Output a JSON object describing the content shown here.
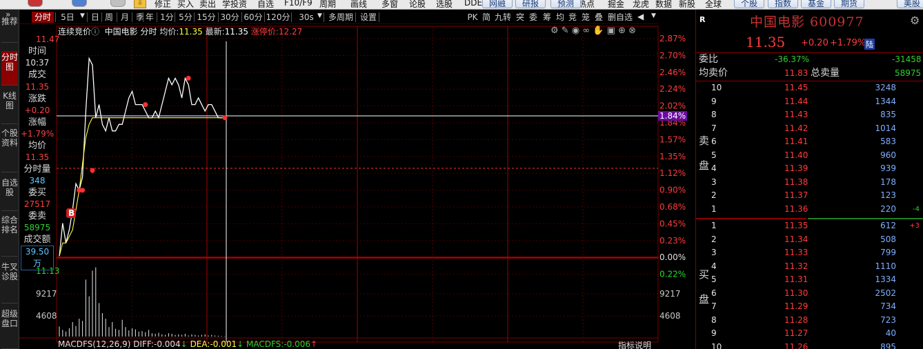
{
  "toolbar": {
    "items": [
      "修正",
      "买入",
      "卖出",
      "学投资",
      "自选",
      "F10/F9",
      "周期",
      "画线",
      "多窗",
      "论股",
      "选股",
      "DDE",
      "热点",
      "掘金",
      "龙虎",
      "数据",
      "新股",
      "全球"
    ],
    "buttons": [
      "网融",
      "研报",
      "预测",
      "个股",
      "指数",
      "基金",
      "期货",
      "美股"
    ]
  },
  "leftnav": [
    "推荐",
    "分时图",
    "K线图",
    "个股资料",
    "自选股",
    "综合排名",
    "牛叉诊股",
    "超级盘口"
  ],
  "periodbar": {
    "items": [
      "分时",
      "5日",
      "日",
      "周",
      "月",
      "季",
      "年",
      "1分",
      "5分",
      "15分",
      "30分",
      "60分",
      "120分",
      "30s",
      "多周期",
      "设置"
    ],
    "right": [
      "PK",
      "简",
      "九转",
      "突",
      "委",
      "筹",
      "均",
      "竞",
      "笼",
      "叠",
      "删自选"
    ]
  },
  "chart_title": {
    "mode": "连续竞价",
    "name": "中国电影",
    "view": "分时",
    "avg_label": "均价:",
    "avg_value": "11.35",
    "last_label": "最新:",
    "last_value": "11.35",
    "limit_label": "涨停价:",
    "limit_value": "12.27"
  },
  "info": {
    "time_label": "时间",
    "time": "10:37",
    "deal_label": "成交",
    "deal": "11.35",
    "change_label": "涨跌",
    "change": "+0.20",
    "pct_label": "涨幅",
    "pct": "+1.79%",
    "avg_label": "均价",
    "avg": "11.35",
    "vol_label": "分时量",
    "vol": "348",
    "bid_label": "委买",
    "bid": "27517",
    "ask_label": "委卖",
    "ask": "58975",
    "amt_label": "成交额",
    "amt": "39.50万"
  },
  "chart_data": {
    "type": "line",
    "y_left_top": "11.47",
    "y_left_bottom": "11.13",
    "pct_ticks": [
      "2.87%",
      "2.70%",
      "2.46%",
      "2.24%",
      "2.02%",
      "1.84%",
      "1.57%",
      "1.35%",
      "1.12%",
      "0.90%",
      "0.68%",
      "0.45%",
      "0.23%",
      "0.00%",
      "0.22%"
    ],
    "current_pct": "1.84%",
    "vol_ticks": [
      "9217",
      "4608"
    ],
    "buy_marker": "B",
    "price_series": [
      11.14,
      11.19,
      11.16,
      11.18,
      11.21,
      11.25,
      11.24,
      11.26,
      11.36,
      11.44,
      11.43,
      11.35,
      11.37,
      11.34,
      11.33,
      11.35,
      11.33,
      11.33,
      11.34,
      11.34,
      11.36,
      11.38,
      11.39,
      11.37,
      11.37,
      11.37,
      11.36,
      11.35,
      11.35,
      11.36,
      11.35,
      11.37,
      11.39,
      11.41,
      11.4,
      11.41,
      11.4,
      11.38,
      11.41,
      11.4,
      11.37,
      11.37,
      11.38,
      11.37,
      11.36,
      11.37,
      11.37,
      11.36,
      11.35,
      11.35,
      11.35
    ],
    "avg_series": [
      11.14,
      11.16,
      11.16,
      11.17,
      11.18,
      11.21,
      11.24,
      11.28,
      11.32,
      11.34,
      11.35,
      11.35,
      11.35,
      11.35,
      11.35,
      11.35,
      11.35,
      11.35,
      11.35,
      11.35,
      11.35,
      11.35,
      11.35,
      11.35,
      11.35,
      11.35,
      11.35,
      11.35,
      11.35,
      11.35,
      11.35,
      11.35,
      11.35,
      11.35,
      11.35,
      11.35,
      11.35,
      11.35,
      11.35,
      11.35,
      11.35,
      11.35,
      11.35,
      11.35,
      11.35,
      11.35,
      11.35,
      11.35,
      11.35,
      11.35,
      11.35
    ],
    "volume_series": [
      1800,
      1200,
      900,
      1500,
      2600,
      1900,
      3200,
      2800,
      10200,
      7200,
      11800,
      12400,
      6000,
      4200,
      3200,
      1700,
      2600,
      1400,
      1200,
      3000,
      1700,
      1100,
      1500,
      1300,
      900,
      1000,
      800,
      1200,
      600,
      500,
      700,
      400,
      300,
      600,
      500,
      300,
      400,
      300,
      500,
      200,
      400,
      300,
      200,
      300,
      400,
      200,
      300,
      200,
      150,
      100,
      80
    ],
    "prev_close": 11.15
  },
  "macd": {
    "label": "MACDFS(12,26,9)",
    "diff_label": "DIFF:",
    "diff": "-0.004",
    "dea_label": "DEA:",
    "dea": "-0.001",
    "macdfs_label": "MACDFS:",
    "macdfs": "-0.006",
    "help": "指标说明"
  },
  "quote": {
    "title": "中国电影 600977",
    "badge": "R",
    "price": "11.35",
    "change": "+0.20",
    "pct": "+1.79%",
    "exchange": "陆",
    "weibi_label": "委比",
    "weibi": "-36.37%",
    "weicha": "-31458",
    "avg_ask_label": "均卖价",
    "avg_ask": "11.83",
    "total_ask_label": "总卖量",
    "total_ask": "58975",
    "sell_label": [
      "卖",
      "盘"
    ],
    "buy_label": [
      "买",
      "盘"
    ],
    "sell": [
      {
        "lv": "10",
        "price": "11.45",
        "vol": "3248",
        "chg": ""
      },
      {
        "lv": "9",
        "price": "11.44",
        "vol": "1344",
        "chg": ""
      },
      {
        "lv": "8",
        "price": "11.43",
        "vol": "835",
        "chg": ""
      },
      {
        "lv": "7",
        "price": "11.42",
        "vol": "1014",
        "chg": ""
      },
      {
        "lv": "6",
        "price": "11.41",
        "vol": "583",
        "chg": ""
      },
      {
        "lv": "5",
        "price": "11.40",
        "vol": "960",
        "chg": ""
      },
      {
        "lv": "4",
        "price": "11.39",
        "vol": "939",
        "chg": ""
      },
      {
        "lv": "3",
        "price": "11.38",
        "vol": "178",
        "chg": ""
      },
      {
        "lv": "2",
        "price": "11.37",
        "vol": "123",
        "chg": ""
      },
      {
        "lv": "1",
        "price": "11.36",
        "vol": "220",
        "chg": "-4"
      }
    ],
    "buy": [
      {
        "lv": "1",
        "price": "11.35",
        "vol": "612",
        "chg": "+3"
      },
      {
        "lv": "2",
        "price": "11.34",
        "vol": "508",
        "chg": ""
      },
      {
        "lv": "3",
        "price": "11.33",
        "vol": "799",
        "chg": ""
      },
      {
        "lv": "4",
        "price": "11.32",
        "vol": "1110",
        "chg": ""
      },
      {
        "lv": "5",
        "price": "11.31",
        "vol": "1334",
        "chg": ""
      },
      {
        "lv": "6",
        "price": "11.30",
        "vol": "2502",
        "chg": ""
      },
      {
        "lv": "7",
        "price": "11.29",
        "vol": "734",
        "chg": ""
      },
      {
        "lv": "8",
        "price": "11.28",
        "vol": "723",
        "chg": ""
      },
      {
        "lv": "9",
        "price": "11.27",
        "vol": "40",
        "chg": ""
      },
      {
        "lv": "10",
        "price": "11.26",
        "vol": "895",
        "chg": ""
      }
    ]
  },
  "colors": {
    "red": "#ff3c3c",
    "green": "#20e020",
    "cyan": "#30a0ff",
    "gridred": "#7a0000",
    "white": "#ffffff",
    "yellow": "#ffff40"
  }
}
